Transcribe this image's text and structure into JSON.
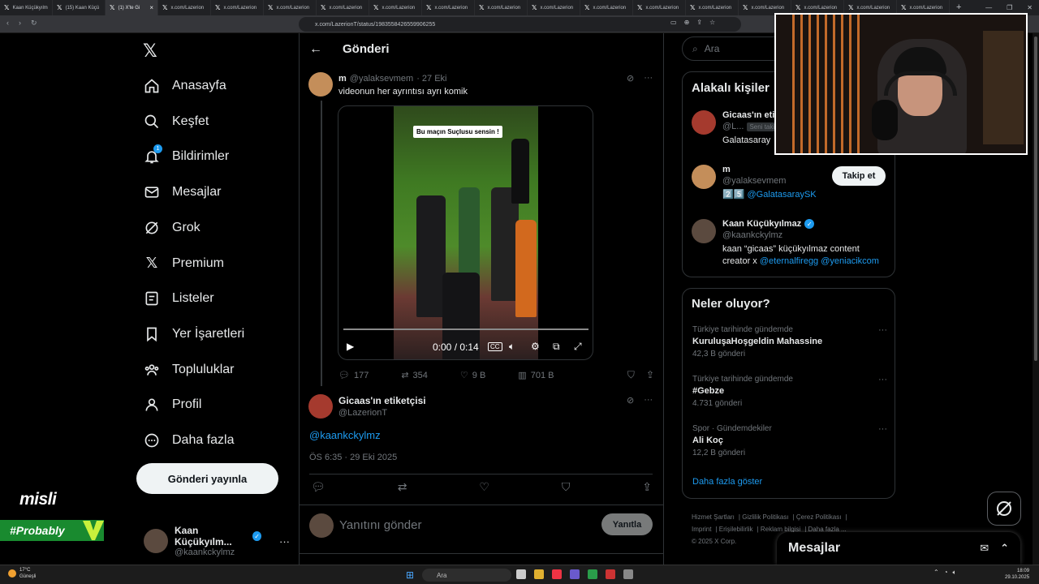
{
  "browser": {
    "tabs": [
      {
        "label": "Kaan Küçükyılm",
        "active": false
      },
      {
        "label": "(15) Kaan Küçü",
        "active": false
      },
      {
        "label": "(1) X'te Gi",
        "active": true
      },
      {
        "label": "x.com/Lazerion",
        "active": false
      },
      {
        "label": "x.com/Lazerion",
        "active": false
      },
      {
        "label": "x.com/Lazerion",
        "active": false
      },
      {
        "label": "x.com/Lazerion",
        "active": false
      },
      {
        "label": "x.com/Lazerion",
        "active": false
      },
      {
        "label": "x.com/Lazerion",
        "active": false
      },
      {
        "label": "x.com/Lazerion",
        "active": false
      },
      {
        "label": "x.com/Lazerion",
        "active": false
      },
      {
        "label": "x.com/Lazerion",
        "active": false
      },
      {
        "label": "x.com/Lazerion",
        "active": false
      },
      {
        "label": "x.com/Lazerion",
        "active": false
      },
      {
        "label": "x.com/Lazerion",
        "active": false
      },
      {
        "label": "x.com/Lazerion",
        "active": false
      },
      {
        "label": "x.com/Lazerion",
        "active": false
      },
      {
        "label": "x.com/Lazerion",
        "active": false
      }
    ],
    "url": "x.com/LazerionT/status/1983558426559906255"
  },
  "nav": {
    "items": [
      {
        "label": "Anasayfa",
        "icon": "home-icon"
      },
      {
        "label": "Keşfet",
        "icon": "search-icon"
      },
      {
        "label": "Bildirimler",
        "icon": "bell-icon",
        "badge": "1"
      },
      {
        "label": "Mesajlar",
        "icon": "mail-icon"
      },
      {
        "label": "Grok",
        "icon": "grok-icon"
      },
      {
        "label": "Premium",
        "icon": "x-logo-icon"
      },
      {
        "label": "Listeler",
        "icon": "list-icon"
      },
      {
        "label": "Yer İşaretleri",
        "icon": "bookmark-icon"
      },
      {
        "label": "Topluluklar",
        "icon": "communities-icon"
      },
      {
        "label": "Profil",
        "icon": "profile-icon"
      },
      {
        "label": "Daha fazla",
        "icon": "more-circle-icon"
      }
    ],
    "post_button": "Gönderi yayınla",
    "account": {
      "name": "Kaan Küçükyılm...",
      "handle": "@kaankckylmz"
    }
  },
  "sponsor": {
    "brand": "misli",
    "tag": "#Probably"
  },
  "header": {
    "title": "Gönderi"
  },
  "quoted_post": {
    "author": "m",
    "handle": "@yalaksevmem",
    "date": "· 27 Eki",
    "text": "videonun her ayrıntısı ayrı komik",
    "video": {
      "caption": "Bu maçın Suçlusu sensin !",
      "time": "0:00 / 0:14",
      "progress": 0
    },
    "stats": {
      "replies": "177",
      "reposts": "354",
      "likes": "9 B",
      "views": "701 B"
    }
  },
  "main_post": {
    "author": "Gicaas'ın etiketçisi",
    "handle": "@LazerionT",
    "text": "@kaankckylmz",
    "timestamp": "ÖS 6:35 · 29 Eki 2025"
  },
  "reply": {
    "placeholder": "Yanıtını gönder",
    "button": "Yanıtla"
  },
  "sidebar": {
    "search_placeholder": "Ara",
    "related_title": "Alakalı kişiler",
    "related": [
      {
        "name": "Gicaas'ın eti",
        "handle": "@L...",
        "tag": "Seni takip",
        "bio": "Galatasaray"
      },
      {
        "name": "m",
        "handle": "@yalaksevmem",
        "bio_emoji": "2️⃣5️⃣",
        "bio_link": "@GalatasaraySK",
        "follow": "Takip et"
      },
      {
        "name": "Kaan Küçükyılmaz",
        "handle": "@kaankckylmz",
        "bio": "kaan “gicaas” küçükyılmaz content creator x",
        "bio_links": "@eternalfiregg @yeniacikcom",
        "verified": true
      }
    ],
    "trends_title": "Neler oluyor?",
    "trends": [
      {
        "context": "Türkiye tarihinde gündemde",
        "topic": "KuruluşaHoşgeldin Mahassine",
        "posts": "42,3 B gönderi"
      },
      {
        "context": "Türkiye tarihinde gündemde",
        "topic": "#Gebze",
        "posts": "4.731 gönderi"
      },
      {
        "context": "Spor · Gündemdekiler",
        "topic": "Ali Koç",
        "posts": "12,2 B gönderi"
      }
    ],
    "show_more": "Daha fazla göster",
    "footer_links": [
      "Hizmet Şartları",
      "Gizlilik Politikası",
      "Çerez Politikası",
      "Imprint",
      "Erişilebilirlik",
      "Reklam bilgisi",
      "Daha fazla ..."
    ],
    "copyright": "© 2025 X Corp."
  },
  "messages_drawer": {
    "title": "Mesajlar"
  },
  "taskbar": {
    "weather_temp": "17°C",
    "weather_desc": "Güneşli",
    "search": "Ara",
    "time": "18:09",
    "date": "29.10.2025"
  },
  "colors": {
    "accent": "#1d9bf0",
    "background": "#000000",
    "border": "#2f3336",
    "muted": "#71767b"
  }
}
